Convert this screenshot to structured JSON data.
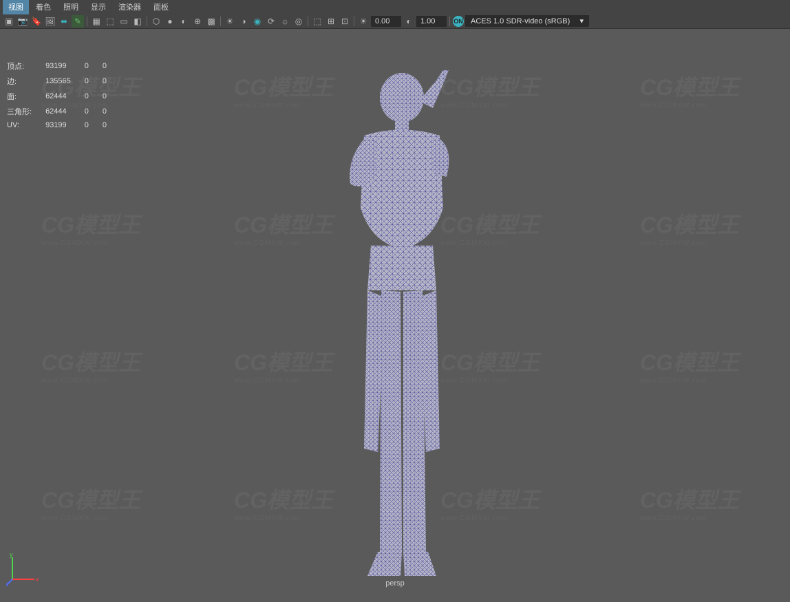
{
  "menu": {
    "items": [
      "视图",
      "着色",
      "照明",
      "显示",
      "渲染器",
      "面板"
    ],
    "active_index": 0
  },
  "toolbar": {
    "num1": "0.00",
    "num2": "1.00",
    "color_space": "ACES 1.0 SDR-video (sRGB)",
    "on_indicator": "ON"
  },
  "stats": {
    "rows": [
      {
        "label": "顶点:",
        "c1": "93199",
        "c2": "0",
        "c3": "0"
      },
      {
        "label": "边:",
        "c1": "135565",
        "c2": "0",
        "c3": "0"
      },
      {
        "label": "面:",
        "c1": "62444",
        "c2": "0",
        "c3": "0"
      },
      {
        "label": "三角形:",
        "c1": "62444",
        "c2": "0",
        "c3": "0"
      },
      {
        "label": "UV:",
        "c1": "93199",
        "c2": "0",
        "c3": "0"
      }
    ]
  },
  "viewport": {
    "camera_label": "persp",
    "watermark_text": "CG模型王",
    "watermark_url": "www.CGMXW.com"
  },
  "axis": {
    "x": "x",
    "y": "y",
    "z": "z"
  }
}
